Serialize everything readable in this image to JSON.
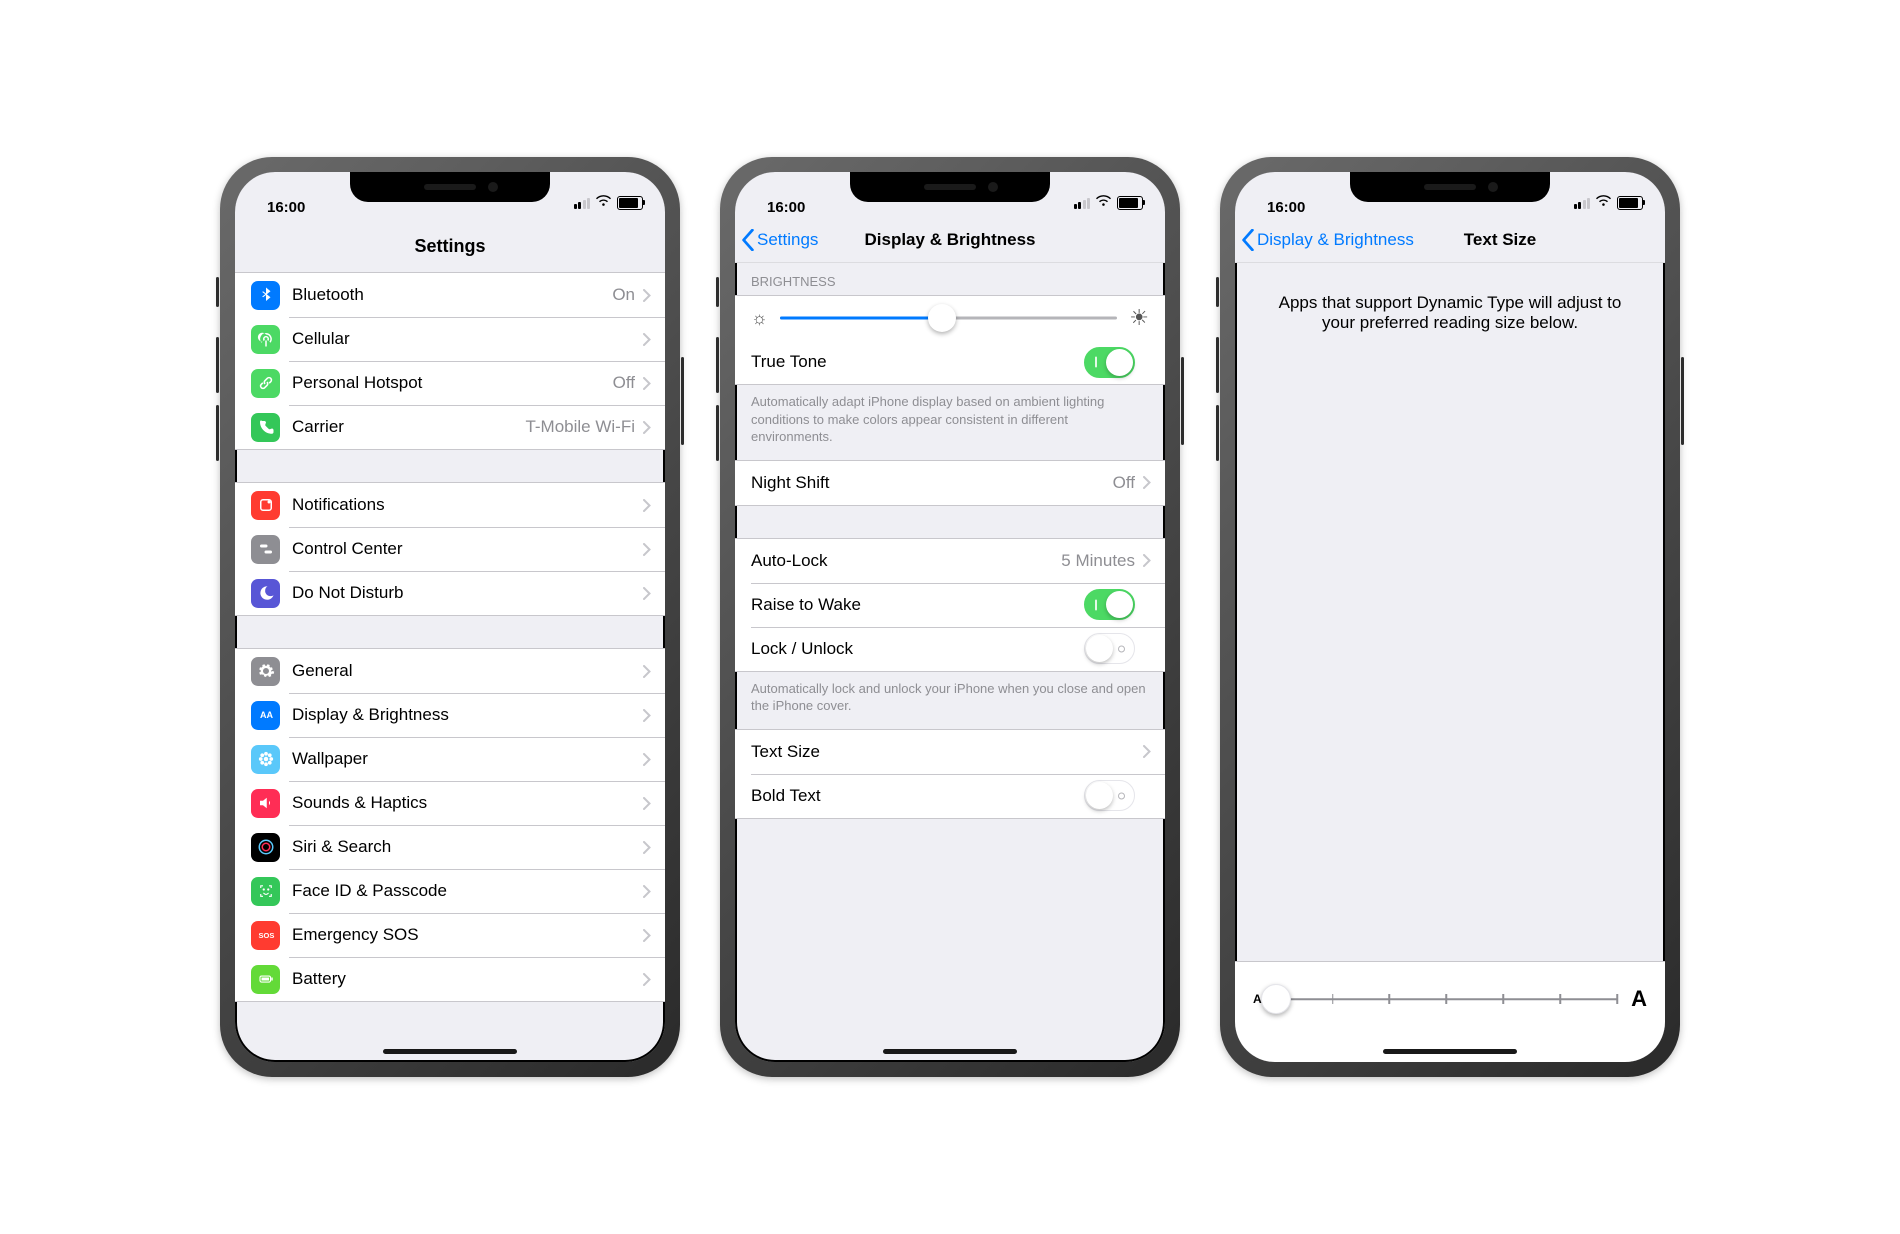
{
  "status": {
    "time": "16:00"
  },
  "settings": {
    "title": "Settings",
    "group1": [
      {
        "icon": "bluetooth",
        "color": "c-blue",
        "label": "Bluetooth",
        "detail": "On"
      },
      {
        "icon": "antenna",
        "color": "c-green",
        "label": "Cellular",
        "detail": ""
      },
      {
        "icon": "link",
        "color": "c-green",
        "label": "Personal Hotspot",
        "detail": "Off"
      },
      {
        "icon": "phone",
        "color": "c-green2",
        "label": "Carrier",
        "detail": "T-Mobile Wi-Fi"
      }
    ],
    "group2": [
      {
        "icon": "bell",
        "color": "c-red",
        "label": "Notifications"
      },
      {
        "icon": "toggles",
        "color": "c-gray",
        "label": "Control Center"
      },
      {
        "icon": "moon",
        "color": "c-indigo",
        "label": "Do Not Disturb"
      }
    ],
    "group3": [
      {
        "icon": "gear",
        "color": "c-gray",
        "label": "General"
      },
      {
        "icon": "aa",
        "color": "c-blue",
        "label": "Display & Brightness"
      },
      {
        "icon": "flower",
        "color": "c-teal",
        "label": "Wallpaper"
      },
      {
        "icon": "speaker",
        "color": "c-pink",
        "label": "Sounds & Haptics"
      },
      {
        "icon": "siri",
        "color": "c-black",
        "label": "Siri & Search"
      },
      {
        "icon": "faceid",
        "color": "c-green2",
        "label": "Face ID & Passcode"
      },
      {
        "icon": "sos",
        "color": "c-red",
        "label": "Emergency SOS"
      },
      {
        "icon": "battery",
        "color": "c-green3",
        "label": "Battery"
      }
    ]
  },
  "display": {
    "back": "Settings",
    "title": "Display & Brightness",
    "brightness_header": "BRIGHTNESS",
    "brightness_pct": 48,
    "true_tone": {
      "label": "True Tone",
      "on": true
    },
    "true_tone_footer": "Automatically adapt iPhone display based on ambient lighting conditions to make colors appear consistent in different environments.",
    "night_shift": {
      "label": "Night Shift",
      "detail": "Off"
    },
    "auto_lock": {
      "label": "Auto-Lock",
      "detail": "5 Minutes"
    },
    "raise_to_wake": {
      "label": "Raise to Wake",
      "on": true
    },
    "lock_unlock": {
      "label": "Lock / Unlock",
      "on": false
    },
    "lock_footer": "Automatically lock and unlock your iPhone when you close and open the iPhone cover.",
    "text_size": {
      "label": "Text Size"
    },
    "bold_text": {
      "label": "Bold Text",
      "on": false
    }
  },
  "textsize": {
    "back": "Display & Brightness",
    "title": "Text Size",
    "intro": "Apps that support Dynamic Type will adjust to your preferred reading size below.",
    "steps": 7,
    "pos": 0,
    "small_label": "A",
    "large_label": "A"
  }
}
